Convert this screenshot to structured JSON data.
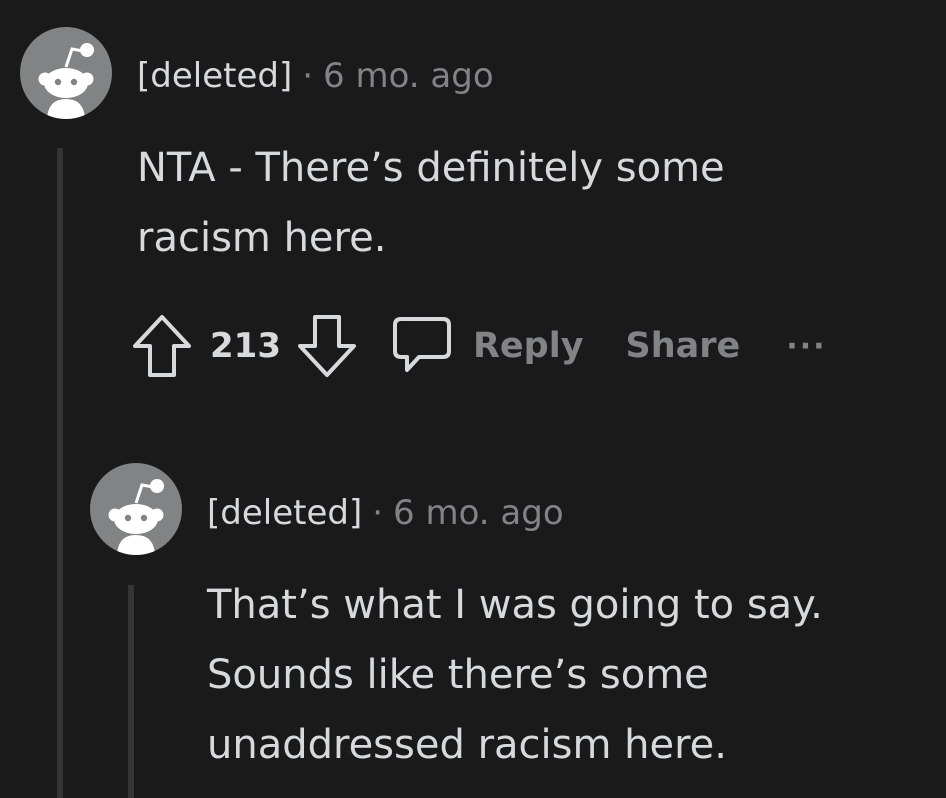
{
  "comments": [
    {
      "author": "[deleted]",
      "separator": "·",
      "timestamp": "6 mo. ago",
      "body_lines": [
        "NTA - There’s definitely some",
        "racism here."
      ],
      "score": "213",
      "actions": {
        "reply_label": "Reply",
        "share_label": "Share",
        "more_label": "···"
      }
    },
    {
      "author": "[deleted]",
      "separator": "·",
      "timestamp": "6 mo. ago",
      "body_lines": [
        "That’s what I was going to say.",
        "Sounds like there’s some",
        "unaddressed racism here."
      ]
    }
  ],
  "icons": {
    "avatar": "reddit-snoo-icon",
    "upvote": "upvote-arrow-icon",
    "downvote": "downvote-arrow-icon",
    "comment": "comment-bubble-icon"
  },
  "colors": {
    "background": "#1a1a1b",
    "text": "#d7dadc",
    "muted": "#818384",
    "thread_line": "#343536"
  }
}
